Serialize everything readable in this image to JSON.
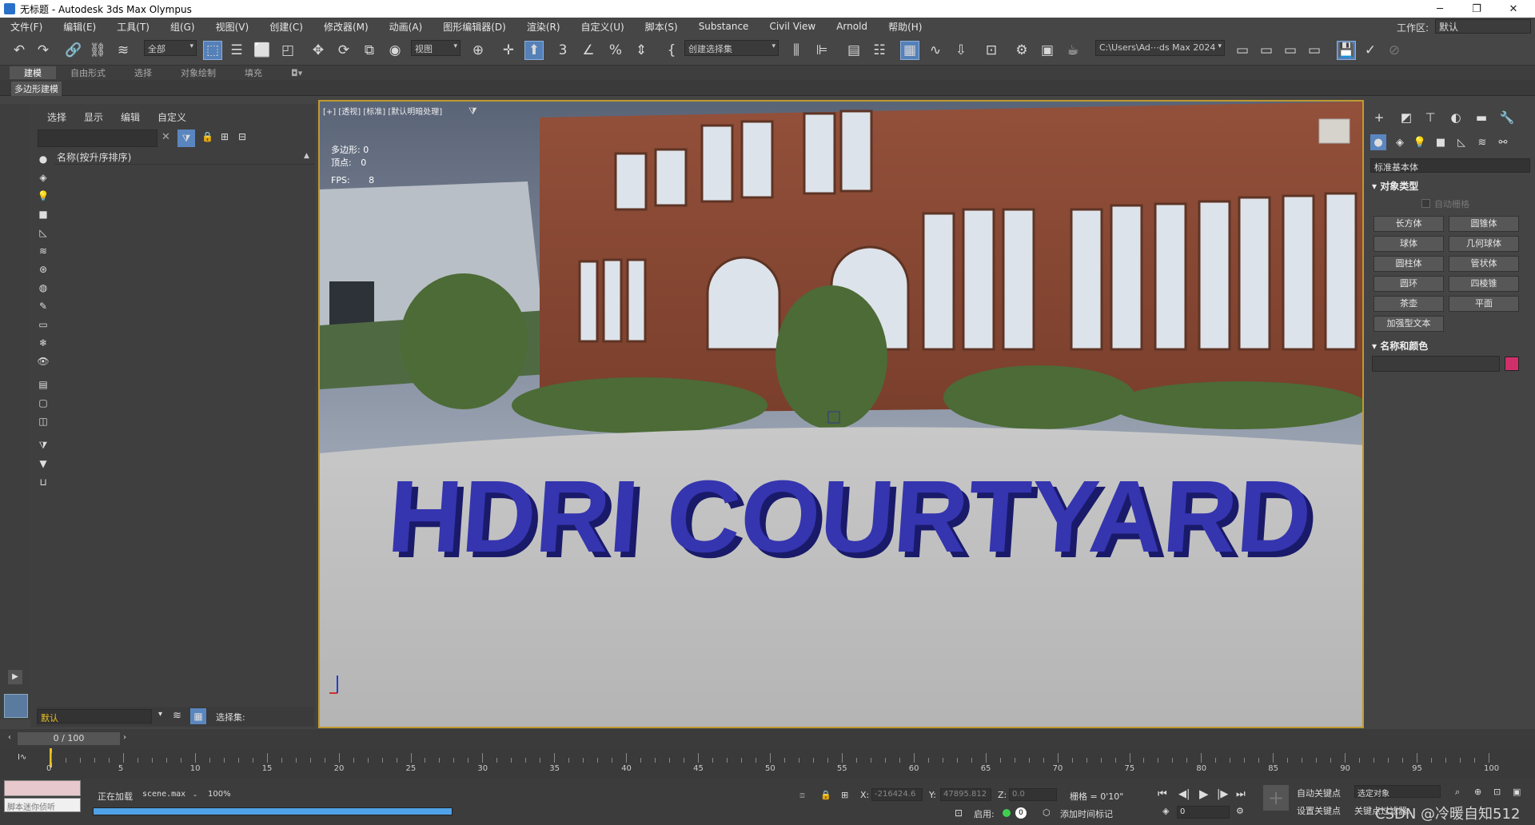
{
  "window": {
    "title": "无标题 - Autodesk 3ds Max Olympus"
  },
  "menu": [
    "文件(F)",
    "编辑(E)",
    "工具(T)",
    "组(G)",
    "视图(V)",
    "创建(C)",
    "修改器(M)",
    "动画(A)",
    "图形编辑器(D)",
    "渲染(R)",
    "自定义(U)",
    "脚本(S)",
    "Substance",
    "Civil View",
    "Arnold",
    "帮助(H)"
  ],
  "workspace": {
    "label": "工作区:",
    "value": "默认"
  },
  "toolbar": {
    "filter": "全部",
    "ref_coord": "视图",
    "selection_set": "创建选择集",
    "project_path": "C:\\Users\\Ad⋯ds Max 2024"
  },
  "ribbon": {
    "tabs": [
      "建模",
      "自由形式",
      "选择",
      "对象绘制",
      "填充"
    ],
    "active": "建模",
    "sub": "多边形建模"
  },
  "scene_explorer": {
    "tabs": [
      "选择",
      "显示",
      "编辑",
      "自定义"
    ],
    "column_header": "名称(按升序排序)"
  },
  "viewport": {
    "label": "[+] [透视] [标准] [默认明暗处理]",
    "stats": {
      "polys_label": "多边形:",
      "polys": "0",
      "verts_label": "顶点:",
      "verts": "0",
      "fps_label": "FPS:",
      "fps": "8"
    },
    "scene_text": "HDRI COURTYARD",
    "text_color": "#3535b0"
  },
  "command_panel": {
    "category": "标准基本体",
    "rollout_object_type": "对象类型",
    "autogrid": "自动栅格",
    "buttons": [
      "长方体",
      "圆锥体",
      "球体",
      "几何球体",
      "圆柱体",
      "管状体",
      "圆环",
      "四棱锥",
      "茶壶",
      "平面",
      "加强型文本"
    ],
    "rollout_name_color": "名称和颜色",
    "swatch_color": "#d0306a"
  },
  "layer": {
    "name": "默认",
    "selection_set_label": "选择集:"
  },
  "timeline": {
    "frame_display": "0 / 100",
    "ticks": [
      "0",
      "5",
      "10",
      "15",
      "20",
      "25",
      "30",
      "35",
      "40",
      "45",
      "50",
      "55",
      "60",
      "65",
      "70",
      "75",
      "80",
      "85",
      "90",
      "95",
      "100"
    ]
  },
  "status": {
    "maxscript_placeholder": "脚本迷你侦听",
    "loading_label": "正在加载",
    "file": "scene.max",
    "separator": "-",
    "percent": "100%",
    "progress": 1.0,
    "x_label": "X:",
    "x": "-216424.6",
    "y_label": "Y:",
    "y": "47895.812",
    "z_label": "Z:",
    "z": "0.0",
    "grid": "栅格 = 0'10\"",
    "enable_label": "启用:",
    "add_time_tag": "添加时间标记",
    "autokey": "自动关键点",
    "setkey": "设置关键点",
    "selected_object": "选定对象",
    "key_filter": "关键点过滤器...",
    "frame": "0",
    "watermark": "CSDN @冷暖自知512"
  }
}
